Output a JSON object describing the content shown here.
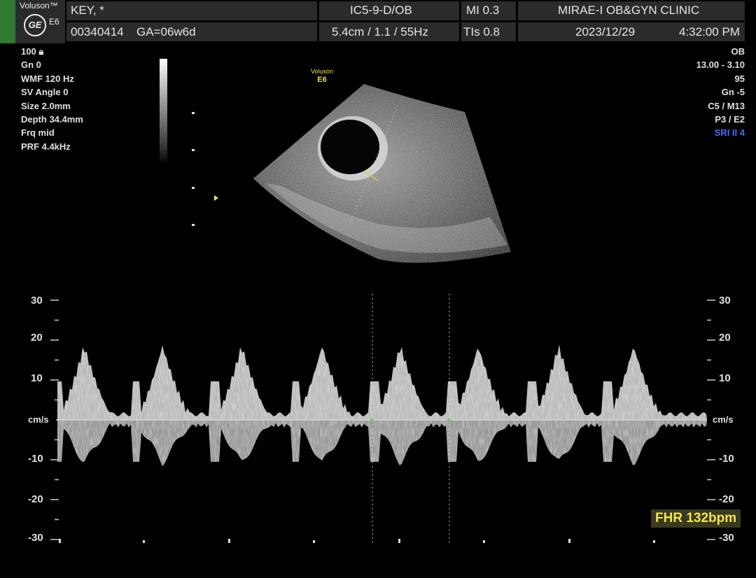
{
  "header": {
    "brand": "Voluson™",
    "model": "E6",
    "patient_name": "KEY,  *",
    "patient_id": "00340414",
    "ga": "GA=06w6d",
    "probe": "IC5-9-D/OB",
    "probe_params": "5.4cm / 1.1 / 55Hz",
    "mi": "MI  0.3",
    "tis": "TIs  0.8",
    "clinic": "MIRAE-I OB&GYN CLINIC",
    "date": "2023/12/29",
    "time": "4:32:00 PM"
  },
  "left_params": {
    "power": "100",
    "gain": "Gn  0",
    "wmf": "WMF 120 Hz",
    "sv_angle": "SV Angle  0",
    "size": "Size  2.0mm",
    "depth": "Depth 34.4mm",
    "frq": "Frq mid",
    "prf": "PRF  4.4kHz"
  },
  "right_params": {
    "mode": "OB",
    "range": "13.00 - 3.10",
    "val": "95",
    "gain": "Gn  -5",
    "c_m": "C5 / M13",
    "p_e": "P3 / E2",
    "sri": "SRI II 4"
  },
  "image_brand": {
    "line1": "Voluson",
    "line2": "E6"
  },
  "doppler": {
    "unit_left": "cm/s",
    "unit_right": "cm/s",
    "ticks": [
      "30",
      "20",
      "10",
      "-10",
      "-20",
      "-30"
    ],
    "tick_values": [
      30,
      20,
      10,
      -10,
      -20,
      -30
    ]
  },
  "fhr": "FHR 132bpm",
  "colors": {
    "accent_yellow": "#f2e44a",
    "sri_blue": "#4b6bff",
    "caliper_green": "#3cd23c"
  }
}
